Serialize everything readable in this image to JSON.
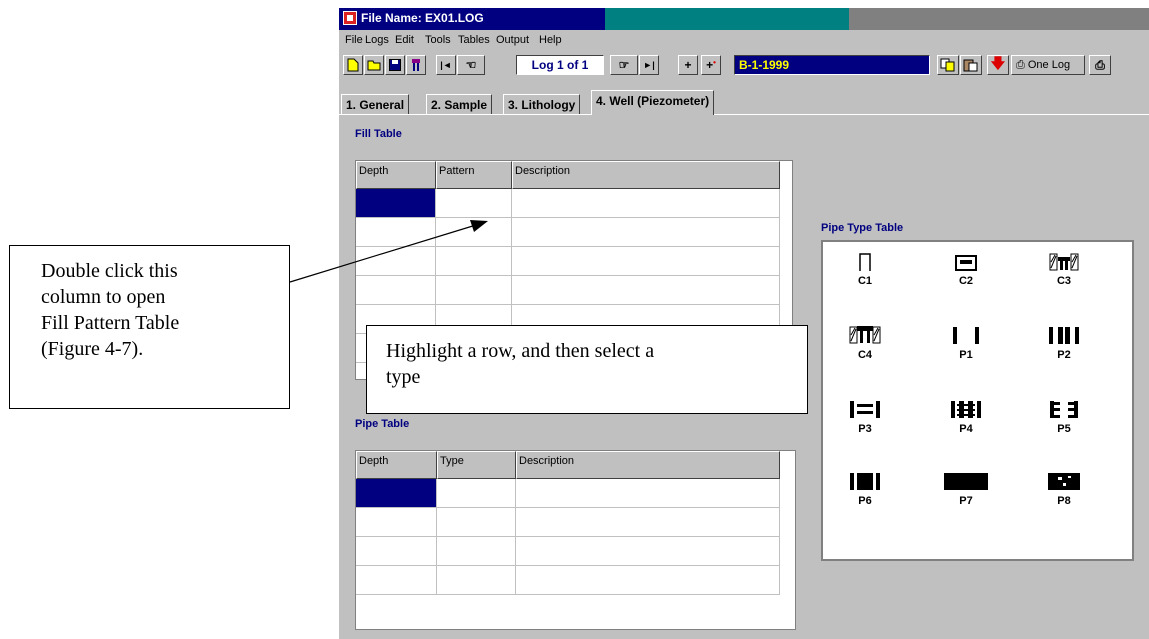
{
  "window": {
    "title": "File Name: EX01.LOG"
  },
  "menu": [
    "File",
    "Logs",
    "Edit",
    "Tools",
    "Tables",
    "Output",
    "Help"
  ],
  "toolbar": {
    "log_counter": "Log 1 of 1",
    "log_name": "B-1-1999",
    "one_log_label": "One Log"
  },
  "tabs": [
    "1. General",
    "2. Sample",
    "3. Lithology",
    "4. Well (Piezometer)"
  ],
  "active_tab": "4. Well (Piezometer)",
  "fill_table": {
    "title": "Fill Table",
    "columns": [
      "Depth",
      "Pattern",
      "Description"
    ]
  },
  "pipe_table": {
    "title": "Pipe Table",
    "columns": [
      "Depth",
      "Type",
      "Description"
    ]
  },
  "pipe_type_table": {
    "title": "Pipe Type Table",
    "types": [
      "C1",
      "C2",
      "C3",
      "C4",
      "P1",
      "P2",
      "P3",
      "P4",
      "P5",
      "P6",
      "P7",
      "P8"
    ]
  },
  "callouts": {
    "left": [
      "Double click this",
      "column to open",
      "Fill Pattern Table",
      "(Figure 4-7)."
    ],
    "middle": [
      "Highlight a row, and then select a",
      "type"
    ]
  },
  "colors": {
    "title_bar": "#000080",
    "selected_cell": "#000080",
    "section_title": "#000080",
    "log_name_text": "#ffff00"
  }
}
